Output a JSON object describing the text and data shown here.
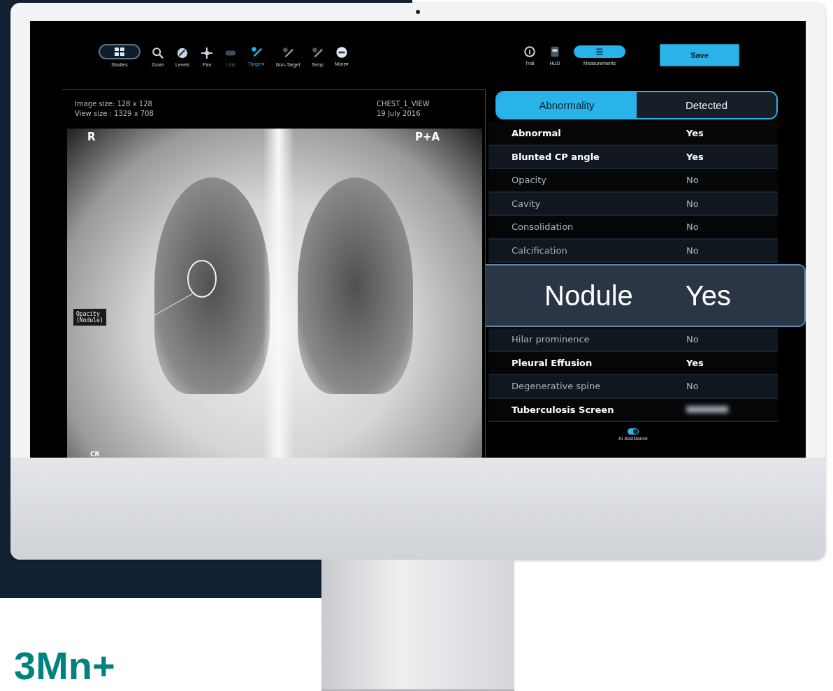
{
  "toolbar": {
    "tools": [
      {
        "label": "Studies",
        "selected": false,
        "disabled": false
      },
      {
        "label": "Zoom",
        "selected": false,
        "disabled": false
      },
      {
        "label": "Levels",
        "selected": false,
        "disabled": false
      },
      {
        "label": "Pan",
        "selected": false,
        "disabled": false
      },
      {
        "label": "Link",
        "selected": false,
        "disabled": true
      },
      {
        "label": "Target",
        "selected": true,
        "disabled": false,
        "caret": "▾"
      },
      {
        "label": "Non-Target",
        "selected": false,
        "disabled": false
      },
      {
        "label": "Temp",
        "selected": false,
        "disabled": false
      },
      {
        "label": "More",
        "selected": false,
        "disabled": false,
        "caret": "▾"
      }
    ],
    "right_tools": [
      {
        "label": "Trial",
        "selected": false
      },
      {
        "label": "HUD",
        "selected": false
      },
      {
        "label": "Measurements",
        "selected": true
      }
    ],
    "save_button": "Save"
  },
  "viewer": {
    "image_size": "Image size: 128 x 128",
    "view_size": "View size : 1329 x 708",
    "study": "CHEST_1_VIEW",
    "date": "19 July 2016",
    "left_marker": "R",
    "orientation": "P+A",
    "modality": "CR",
    "annotation": "Opacity\n(Nodule)"
  },
  "tabs": [
    {
      "label": "Abnormality",
      "selected": true
    },
    {
      "label": "Detected",
      "selected": false
    }
  ],
  "findings": [
    {
      "name": "Abnormal",
      "value": "Yes",
      "positive": true,
      "kind": "row"
    },
    {
      "name": "Blunted CP angle",
      "value": "Yes",
      "positive": true,
      "kind": "row"
    },
    {
      "name": "Opacity",
      "value": "No",
      "positive": false,
      "kind": "row"
    },
    {
      "name": "Cavity",
      "value": "No",
      "positive": false,
      "kind": "row"
    },
    {
      "name": "Consolidation",
      "value": "No",
      "positive": false,
      "kind": "row"
    },
    {
      "name": "Calcification",
      "value": "No",
      "positive": false,
      "kind": "row"
    },
    {
      "name": "Nodule",
      "value": "Yes",
      "positive": true,
      "kind": "callout"
    },
    {
      "name": "Hilar prominence",
      "value": "No",
      "positive": false,
      "kind": "row"
    },
    {
      "name": "Pleural Effusion",
      "value": "Yes",
      "positive": true,
      "kind": "row"
    },
    {
      "name": "Degenerative spine",
      "value": "No",
      "positive": false,
      "kind": "row"
    },
    {
      "name": "Tuberculosis Screen",
      "positive": true,
      "kind": "blurred"
    }
  ],
  "ai_assistance": {
    "label": "AI Assistance",
    "on": true
  },
  "headline": "3Mn+"
}
